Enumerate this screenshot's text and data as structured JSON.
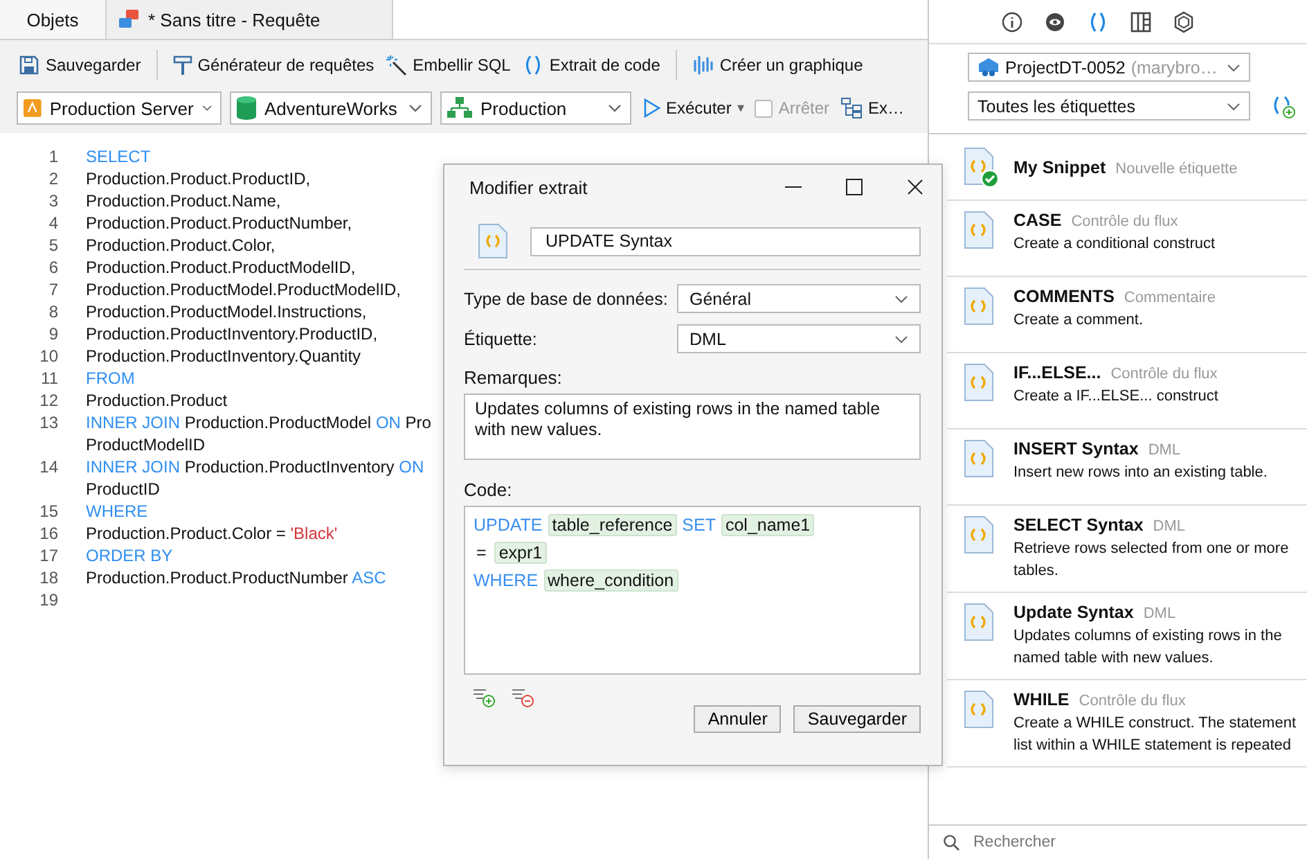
{
  "tabs": [
    {
      "label": "Objets",
      "selected": false,
      "icon": false
    },
    {
      "label": "* Sans titre - Requête",
      "selected": true,
      "icon": true
    }
  ],
  "toolbar": [
    {
      "kind": "save",
      "label": "Sauvegarder"
    },
    {
      "kind": "builder",
      "label": "Générateur de requêtes"
    },
    {
      "kind": "beautify",
      "label": "Embellir SQL"
    },
    {
      "kind": "snippet",
      "label": "Extrait de code"
    },
    {
      "kind": "chart",
      "label": "Créer un graphique"
    }
  ],
  "selectors": [
    {
      "kind": "server",
      "value": "Production Server"
    },
    {
      "kind": "database",
      "value": "AdventureWorks"
    },
    {
      "kind": "schema",
      "value": "Production"
    }
  ],
  "run": {
    "label": "Exécuter",
    "caret": "▾"
  },
  "stop": {
    "label": "Arrêter",
    "checked": false,
    "disabled": true
  },
  "explain": {
    "label": "Ex…"
  },
  "editor_lines": [
    {
      "number": "1",
      "segments": [
        {
          "kind": "kw",
          "text": "SELECT"
        }
      ]
    },
    {
      "number": "2",
      "segments": [
        {
          "kind": "text",
          "text": "Production.Product.ProductID,"
        }
      ]
    },
    {
      "number": "3",
      "segments": [
        {
          "kind": "text",
          "text": "Production.Product.Name,"
        }
      ]
    },
    {
      "number": "4",
      "segments": [
        {
          "kind": "text",
          "text": "Production.Product.ProductNumber,"
        }
      ]
    },
    {
      "number": "5",
      "segments": [
        {
          "kind": "text",
          "text": "Production.Product.Color,"
        }
      ]
    },
    {
      "number": "6",
      "segments": [
        {
          "kind": "text",
          "text": "Production.Product.ProductModelID,"
        }
      ]
    },
    {
      "number": "7",
      "segments": [
        {
          "kind": "text",
          "text": "Production.ProductModel.ProductModelID,"
        }
      ]
    },
    {
      "number": "8",
      "segments": [
        {
          "kind": "text",
          "text": "Production.ProductModel.Instructions,"
        }
      ]
    },
    {
      "number": "9",
      "segments": [
        {
          "kind": "text",
          "text": "Production.ProductInventory.ProductID,"
        }
      ]
    },
    {
      "number": "10",
      "segments": [
        {
          "kind": "text",
          "text": "Production.ProductInventory.Quantity"
        }
      ]
    },
    {
      "number": "11",
      "segments": [
        {
          "kind": "kw",
          "text": "FROM"
        }
      ]
    },
    {
      "number": "12",
      "segments": [
        {
          "kind": "text",
          "text": "Production.Product"
        }
      ]
    },
    {
      "number": "13",
      "segments": [
        {
          "kind": "kw",
          "text": "INNER JOIN"
        },
        {
          "kind": "text",
          "text": "Production.ProductModel"
        },
        {
          "kind": "kw",
          "text": "ON"
        },
        {
          "kind": "text",
          "text": "Pro"
        }
      ]
    },
    {
      "segments": [
        {
          "kind": "text",
          "text": "ProductModelID"
        }
      ]
    },
    {
      "number": "14",
      "segments": [
        {
          "kind": "kw",
          "text": "INNER JOIN"
        },
        {
          "kind": "text",
          "text": "Production.ProductInventory"
        },
        {
          "kind": "kw",
          "text": "ON"
        }
      ]
    },
    {
      "segments": [
        {
          "kind": "text",
          "text": "ProductID"
        }
      ]
    },
    {
      "number": "15",
      "segments": [
        {
          "kind": "kw",
          "text": "WHERE"
        }
      ]
    },
    {
      "number": "16",
      "segments": [
        {
          "kind": "text",
          "text": "Production.Product.Color ="
        },
        {
          "kind": "str",
          "text": "'Black'"
        }
      ]
    },
    {
      "number": "17",
      "segments": [
        {
          "kind": "kw",
          "text": "ORDER BY"
        }
      ]
    },
    {
      "number": "18",
      "segments": [
        {
          "kind": "text",
          "text": "Production.Product.ProductNumber"
        },
        {
          "kind": "kw",
          "text": "ASC"
        }
      ]
    },
    {
      "number": "19"
    }
  ],
  "dialog": {
    "title": "Modifier extrait",
    "name": "UPDATE Syntax",
    "db_type": {
      "label": "Type de base de données:",
      "value": "Général"
    },
    "tag": {
      "label": "Étiquette:",
      "value": "DML"
    },
    "remarks": {
      "label": "Remarques:",
      "value": "Updates columns of existing rows in the named table with new values."
    },
    "code": {
      "label": "Code:",
      "lines": [
        [
          {
            "kind": "kw",
            "text": "UPDATE"
          },
          {
            "kind": "param",
            "text": "table_reference"
          },
          {
            "kind": "kw",
            "text": "SET"
          },
          {
            "kind": "param",
            "text": "col_name1"
          }
        ],
        [
          {
            "kind": "text",
            "text": "="
          },
          {
            "kind": "param",
            "text": "expr1"
          }
        ],
        [
          {
            "kind": "kw",
            "text": "WHERE"
          },
          {
            "kind": "param",
            "text": "where_condition"
          }
        ]
      ]
    },
    "buttons": [
      "Annuler",
      "Sauvegarder"
    ]
  },
  "panel": {
    "icons": [
      {
        "kind": "info",
        "selected": false
      },
      {
        "kind": "eye",
        "selected": false
      },
      {
        "kind": "snippet",
        "selected": true
      },
      {
        "kind": "grid",
        "selected": false
      },
      {
        "kind": "hex",
        "selected": false
      }
    ],
    "project": {
      "name": "ProjectDT-0052",
      "owner": "(marybro…"
    },
    "filter": "Toutes les étiquettes",
    "snippets": [
      {
        "title": "My Snippet",
        "tag": "Nouvelle étiquette",
        "verified": true
      },
      {
        "title": "CASE",
        "tag": "Contrôle du flux",
        "description": "Create a conditional construct",
        "verified": false
      },
      {
        "title": "COMMENTS",
        "tag": "Commentaire",
        "description": "Create a comment.",
        "verified": false
      },
      {
        "title": "IF...ELSE...",
        "tag": "Contrôle du flux",
        "description": "Create a IF...ELSE... construct",
        "verified": false
      },
      {
        "title": "INSERT Syntax",
        "tag": "DML",
        "description": "Insert new rows into an existing table.",
        "verified": false
      },
      {
        "title": "SELECT Syntax",
        "tag": "DML",
        "description": "Retrieve rows selected from one or more tables.",
        "verified": false
      },
      {
        "title": "Update Syntax",
        "tag": "DML",
        "description": "Updates columns of existing rows in the named table with new values.",
        "verified": false
      },
      {
        "title": "WHILE",
        "tag": "Contrôle du flux",
        "description": "Create a WHILE construct. The statement list within a WHILE statement is repeated",
        "verified": false
      }
    ],
    "search": {
      "placeholder": "Rechercher"
    }
  }
}
